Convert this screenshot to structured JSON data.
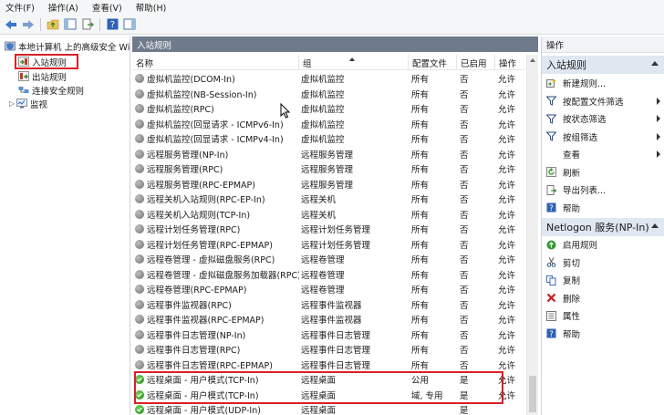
{
  "menu": [
    "文件(F)",
    "操作(A)",
    "查看(V)",
    "帮助(H)"
  ],
  "tree": {
    "root": "本地计算机 上的高级安全 Wind",
    "items": [
      "入站规则",
      "出站规则",
      "连接安全规则",
      "监视"
    ]
  },
  "center": {
    "title": "入站规则",
    "columns": [
      "名称",
      "组",
      "配置文件",
      "已启用",
      "操作"
    ]
  },
  "rows": [
    {
      "name": "虚拟机监控(DCOM-In)",
      "group": "虚拟机监控",
      "profile": "所有",
      "enabled": "否",
      "action": "允许",
      "status": "off"
    },
    {
      "name": "虚拟机监控(NB-Session-In)",
      "group": "虚拟机监控",
      "profile": "所有",
      "enabled": "否",
      "action": "允许",
      "status": "off"
    },
    {
      "name": "虚拟机监控(RPC)",
      "group": "虚拟机监控",
      "profile": "所有",
      "enabled": "否",
      "action": "允许",
      "status": "off"
    },
    {
      "name": "虚拟机监控(回显请求 - ICMPv6-In)",
      "group": "虚拟机监控",
      "profile": "所有",
      "enabled": "否",
      "action": "允许",
      "status": "off"
    },
    {
      "name": "虚拟机监控(回显请求 - ICMPv4-In)",
      "group": "虚拟机监控",
      "profile": "所有",
      "enabled": "否",
      "action": "允许",
      "status": "off"
    },
    {
      "name": "远程服务管理(NP-In)",
      "group": "远程服务管理",
      "profile": "所有",
      "enabled": "否",
      "action": "允许",
      "status": "off"
    },
    {
      "name": "远程服务管理(RPC)",
      "group": "远程服务管理",
      "profile": "所有",
      "enabled": "否",
      "action": "允许",
      "status": "off"
    },
    {
      "name": "远程服务管理(RPC-EPMAP)",
      "group": "远程服务管理",
      "profile": "所有",
      "enabled": "否",
      "action": "允许",
      "status": "off"
    },
    {
      "name": "远程关机入站规则(RPC-EP-In)",
      "group": "远程关机",
      "profile": "所有",
      "enabled": "否",
      "action": "允许",
      "status": "off"
    },
    {
      "name": "远程关机入站规则(TCP-In)",
      "group": "远程关机",
      "profile": "所有",
      "enabled": "否",
      "action": "允许",
      "status": "off"
    },
    {
      "name": "远程计划任务管理(RPC)",
      "group": "远程计划任务管理",
      "profile": "所有",
      "enabled": "否",
      "action": "允许",
      "status": "off"
    },
    {
      "name": "远程计划任务管理(RPC-EPMAP)",
      "group": "远程计划任务管理",
      "profile": "所有",
      "enabled": "否",
      "action": "允许",
      "status": "off"
    },
    {
      "name": "远程卷管理 - 虚拟磁盘服务(RPC)",
      "group": "远程卷管理",
      "profile": "所有",
      "enabled": "否",
      "action": "允许",
      "status": "off"
    },
    {
      "name": "远程卷管理 - 虚拟磁盘服务加载器(RPC)",
      "group": "远程卷管理",
      "profile": "所有",
      "enabled": "否",
      "action": "允许",
      "status": "off"
    },
    {
      "name": "远程卷管理(RPC-EPMAP)",
      "group": "远程卷管理",
      "profile": "所有",
      "enabled": "否",
      "action": "允许",
      "status": "off"
    },
    {
      "name": "远程事件监视器(RPC)",
      "group": "远程事件监视器",
      "profile": "所有",
      "enabled": "否",
      "action": "允许",
      "status": "off"
    },
    {
      "name": "远程事件监视器(RPC-EPMAP)",
      "group": "远程事件监视器",
      "profile": "所有",
      "enabled": "否",
      "action": "允许",
      "status": "off"
    },
    {
      "name": "远程事件日志管理(NP-In)",
      "group": "远程事件日志管理",
      "profile": "所有",
      "enabled": "否",
      "action": "允许",
      "status": "off"
    },
    {
      "name": "远程事件日志管理(RPC)",
      "group": "远程事件日志管理",
      "profile": "所有",
      "enabled": "否",
      "action": "允许",
      "status": "off"
    },
    {
      "name": "远程事件日志管理(RPC-EPMAP)",
      "group": "远程事件日志管理",
      "profile": "所有",
      "enabled": "否",
      "action": "允许",
      "status": "off"
    },
    {
      "name": "远程桌面 - 用户模式(TCP-In)",
      "group": "远程桌面",
      "profile": "公用",
      "enabled": "是",
      "action": "允许",
      "status": "on"
    },
    {
      "name": "远程桌面 - 用户模式(TCP-In)",
      "group": "远程桌面",
      "profile": "域, 专用",
      "enabled": "是",
      "action": "允许",
      "status": "on"
    },
    {
      "name": "远程桌面 - 用户模式(UDP-In)",
      "group": "远程桌面",
      "profile": "",
      "enabled": "是",
      "action": "",
      "status": "on"
    }
  ],
  "actions": {
    "title": "操作",
    "section1": {
      "title": "入站规则",
      "items": [
        {
          "label": "新建规则...",
          "icon": "new-rule-icon",
          "submenu": false
        },
        {
          "label": "按配置文件筛选",
          "icon": "filter-icon",
          "submenu": true
        },
        {
          "label": "按状态筛选",
          "icon": "filter-icon",
          "submenu": true
        },
        {
          "label": "按组筛选",
          "icon": "filter-icon",
          "submenu": true
        },
        {
          "label": "查看",
          "icon": "",
          "submenu": true
        },
        {
          "label": "刷新",
          "icon": "refresh-icon",
          "submenu": false
        },
        {
          "label": "导出列表...",
          "icon": "export-icon",
          "submenu": false
        },
        {
          "label": "帮助",
          "icon": "help-icon",
          "submenu": false
        }
      ]
    },
    "section2": {
      "title": "Netlogon 服务(NP-In)",
      "items": [
        {
          "label": "启用规则",
          "icon": "enable-icon"
        },
        {
          "label": "剪切",
          "icon": "cut-icon"
        },
        {
          "label": "复制",
          "icon": "copy-icon"
        },
        {
          "label": "删除",
          "icon": "delete-icon"
        },
        {
          "label": "属性",
          "icon": "properties-icon"
        },
        {
          "label": "帮助",
          "icon": "help-icon"
        }
      ]
    }
  },
  "colors": {
    "highlight": "#d9202a",
    "title_bar": "#6f7b8b",
    "section_bg": "#dfe7f1",
    "enabled_green": "#1f8a16"
  }
}
